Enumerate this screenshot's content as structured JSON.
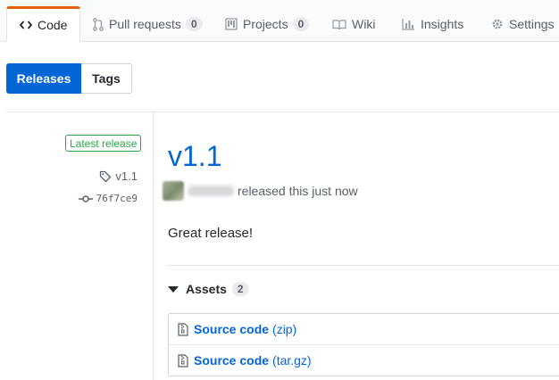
{
  "tabs": {
    "code": "Code",
    "pulls": "Pull requests",
    "pulls_count": "0",
    "projects": "Projects",
    "projects_count": "0",
    "wiki": "Wiki",
    "insights": "Insights",
    "settings": "Settings"
  },
  "switcher": {
    "releases": "Releases",
    "tags": "Tags"
  },
  "release": {
    "badge": "Latest release",
    "tag": "v1.1",
    "commit": "76f7ce9",
    "title": "v1.1",
    "author_action": "released this just now",
    "body": "Great release!"
  },
  "assets": {
    "label": "Assets",
    "count": "2",
    "items": [
      {
        "name": "Source code",
        "format": "(zip)"
      },
      {
        "name": "Source code",
        "format": "(tar.gz)"
      }
    ]
  },
  "colors": {
    "accent": "#0366d6",
    "tab_highlight": "#e36209",
    "badge_green": "#28a745"
  },
  "icons": [
    "code-icon",
    "pull-request-icon",
    "project-icon",
    "wiki-icon",
    "graph-icon",
    "gear-icon",
    "tag-icon",
    "commit-icon",
    "triangle-down-icon",
    "file-zip-icon"
  ]
}
